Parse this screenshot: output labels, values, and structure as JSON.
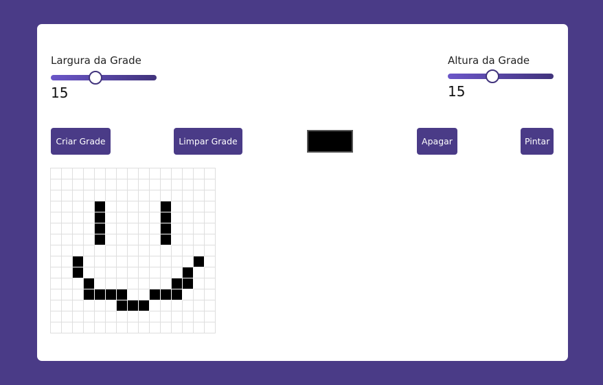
{
  "controls": {
    "width": {
      "label": "Largura da Grade",
      "value": "15",
      "slider_fraction": 0.42
    },
    "height": {
      "label": "Altura da Grade",
      "value": "15",
      "slider_fraction": 0.42
    }
  },
  "buttons": {
    "create": "Criar Grade",
    "clear": "Limpar Grade",
    "erase": "Apagar",
    "paint": "Pintar"
  },
  "color_picker": {
    "value": "#000000"
  },
  "grid": {
    "cols": 15,
    "rows": 15,
    "filled": [
      [
        3,
        4
      ],
      [
        3,
        10
      ],
      [
        4,
        4
      ],
      [
        4,
        10
      ],
      [
        5,
        4
      ],
      [
        5,
        10
      ],
      [
        6,
        4
      ],
      [
        6,
        10
      ],
      [
        8,
        2
      ],
      [
        8,
        13
      ],
      [
        9,
        2
      ],
      [
        9,
        12
      ],
      [
        10,
        3
      ],
      [
        10,
        11
      ],
      [
        10,
        12
      ],
      [
        11,
        3
      ],
      [
        11,
        4
      ],
      [
        11,
        5
      ],
      [
        11,
        6
      ],
      [
        11,
        9
      ],
      [
        11,
        10
      ],
      [
        11,
        11
      ],
      [
        12,
        6
      ],
      [
        12,
        7
      ],
      [
        12,
        8
      ]
    ]
  }
}
